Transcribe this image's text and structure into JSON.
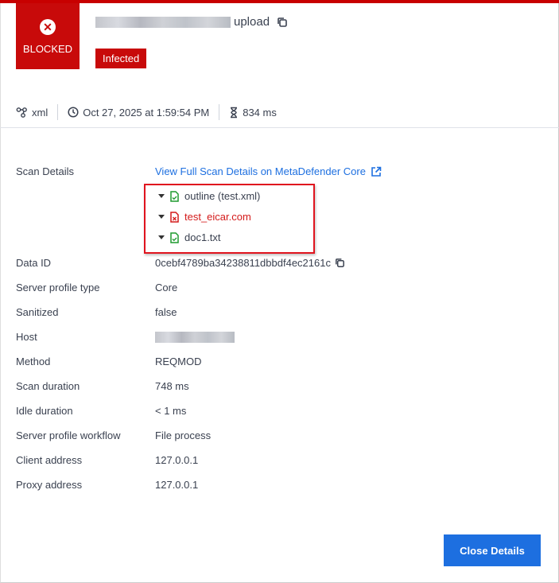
{
  "header": {
    "status": "BLOCKED",
    "file_name_suffix": "upload",
    "verdict": "Infected",
    "verdict_color": "#c80a0a"
  },
  "meta": {
    "type": "xml",
    "timestamp": "Oct 27, 2025 at 1:59:54 PM",
    "duration": "834 ms"
  },
  "details": {
    "scan_details_label": "Scan Details",
    "scan_link": "View Full Scan Details on MetaDefender Core",
    "tree": [
      {
        "name": "outline (test.xml)",
        "status": "clean"
      },
      {
        "name": "test_eicar.com",
        "status": "infected"
      },
      {
        "name": "doc1.txt",
        "status": "clean"
      }
    ],
    "rows": [
      {
        "label": "Data ID",
        "value": "0cebf4789ba34238811dbbdf4ec2161c"
      },
      {
        "label": "Server profile type",
        "value": "Core"
      },
      {
        "label": "Sanitized",
        "value": "false"
      },
      {
        "label": "Host",
        "value": ""
      },
      {
        "label": "Method",
        "value": "REQMOD"
      },
      {
        "label": "Scan duration",
        "value": "748 ms"
      },
      {
        "label": "Idle duration",
        "value": "< 1 ms"
      },
      {
        "label": "Server profile workflow",
        "value": "File process"
      },
      {
        "label": "Client address",
        "value": "127.0.0.1"
      },
      {
        "label": "Proxy address",
        "value": "127.0.0.1"
      }
    ]
  },
  "footer": {
    "close_label": "Close Details"
  }
}
